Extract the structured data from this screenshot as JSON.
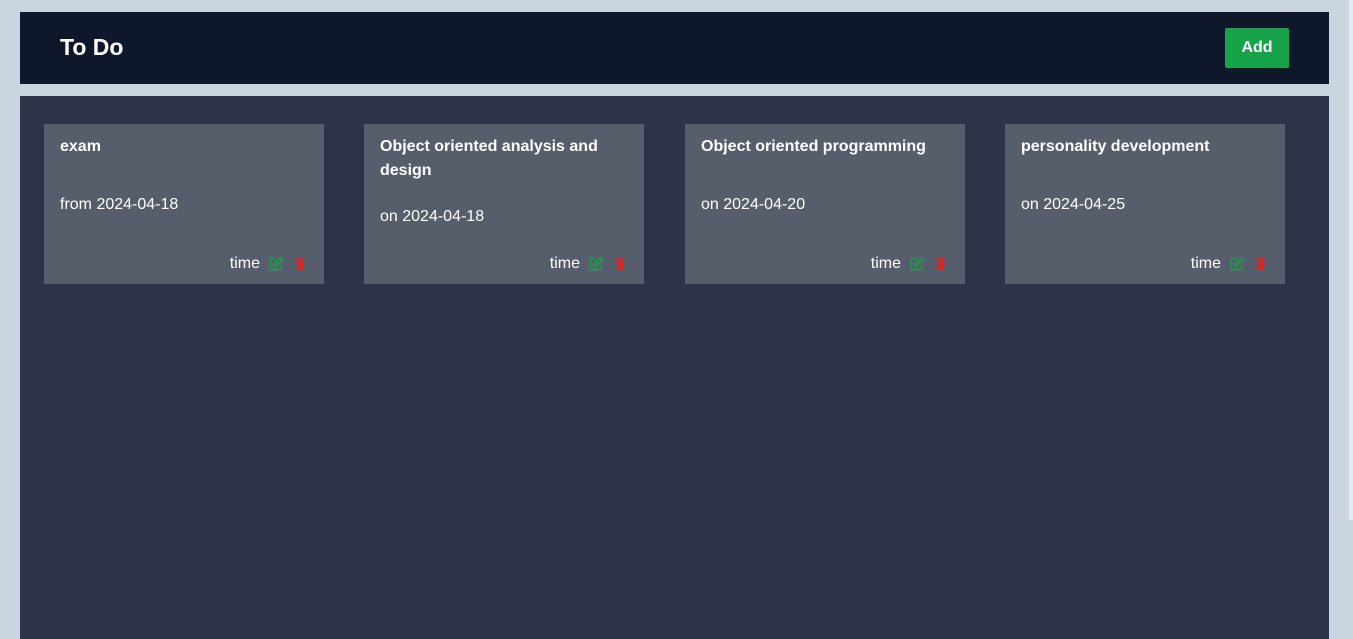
{
  "header": {
    "title": "To Do",
    "add_label": "Add"
  },
  "colors": {
    "header_bg": "#0f172a",
    "main_bg": "#2d3447",
    "card_bg": "#565e6c",
    "accent_green": "#16a34a",
    "delete_red": "#dc2626"
  },
  "todos": [
    {
      "title": "exam",
      "date": "from 2024-04-18",
      "time_label": "time",
      "edit_icon": "edit-icon",
      "delete_icon": "trash-icon"
    },
    {
      "title": "Object oriented analysis and design",
      "date": "on 2024-04-18",
      "time_label": "time",
      "edit_icon": "edit-icon",
      "delete_icon": "trash-icon"
    },
    {
      "title": "Object oriented programming",
      "date": "on 2024-04-20",
      "time_label": "time",
      "edit_icon": "edit-icon",
      "delete_icon": "trash-icon"
    },
    {
      "title": "personality development",
      "date": "on 2024-04-25",
      "time_label": "time",
      "edit_icon": "edit-icon",
      "delete_icon": "trash-icon"
    }
  ]
}
